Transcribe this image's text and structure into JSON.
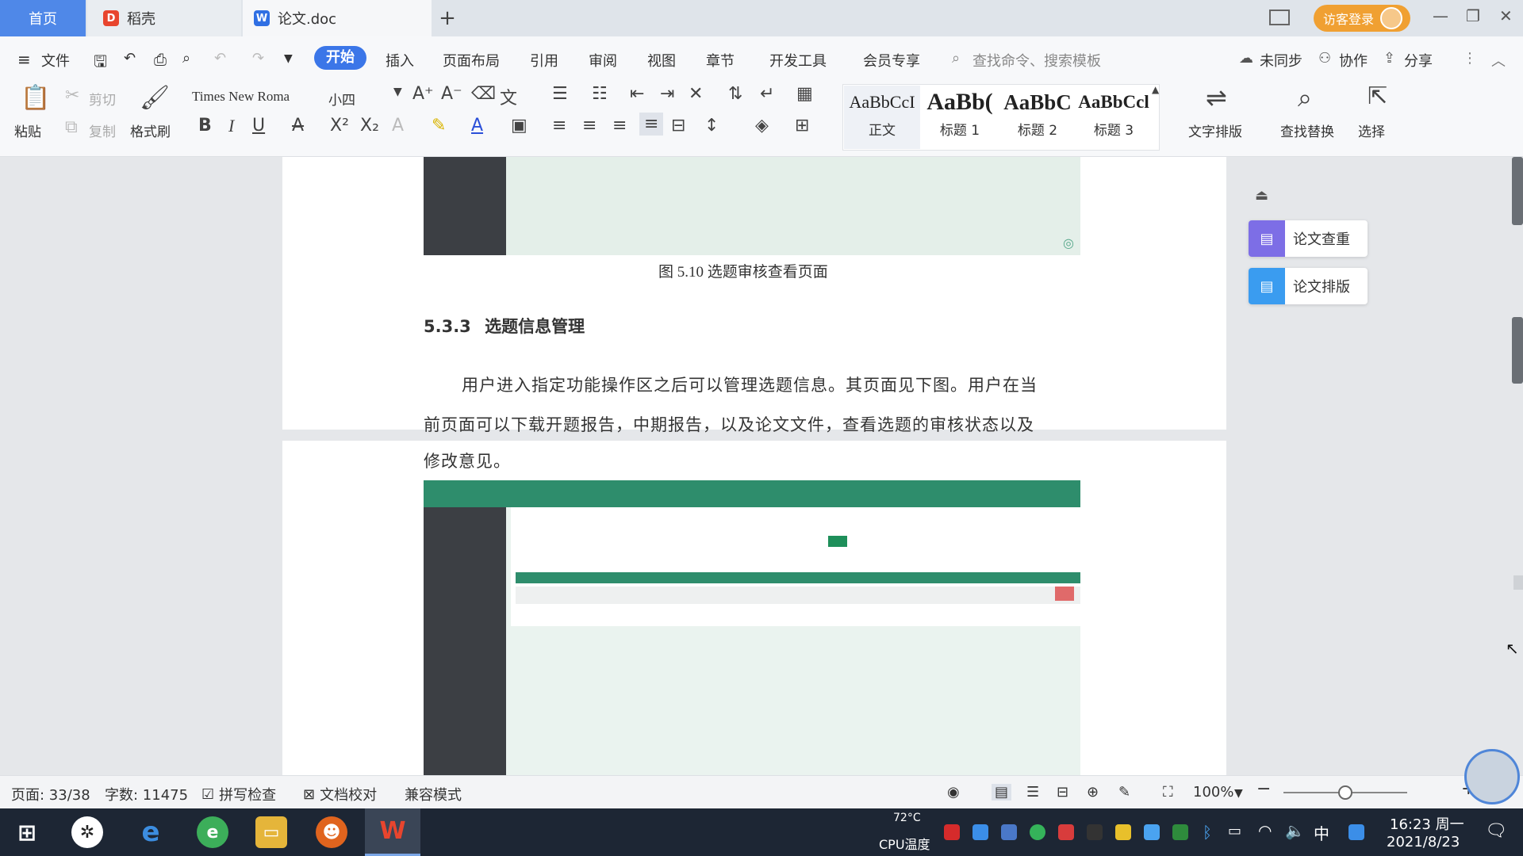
{
  "tabs": {
    "home": "首页",
    "daoke": "稻壳",
    "doc": "论文.doc",
    "add": "+"
  },
  "titlebar": {
    "login": "访客登录"
  },
  "menu": {
    "file": "文件",
    "items": [
      "开始",
      "插入",
      "页面布局",
      "引用",
      "审阅",
      "视图",
      "章节",
      "开发工具",
      "会员专享"
    ],
    "search_placeholder": "查找命令、搜索模板",
    "sync": "未同步",
    "collab": "协作",
    "share": "分享"
  },
  "ribbon": {
    "paste": "粘贴",
    "cut": "剪切",
    "copy": "复制",
    "format_painter": "格式刷",
    "font_name": "Times New Roma",
    "font_size": "小四",
    "styles": [
      {
        "preview": "AaBbCcI",
        "name": "正文"
      },
      {
        "preview": "AaBb(",
        "name": "标题 1"
      },
      {
        "preview": "AaBbC",
        "name": "标题 2"
      },
      {
        "preview": "AaBbCcl",
        "name": "标题 3"
      }
    ],
    "text_layout": "文字排版",
    "find_replace": "查找替换",
    "select": "选择"
  },
  "document": {
    "figure_caption": "图 5.10  选题审核查看页面",
    "section_number": "5.3.3",
    "section_title": "选题信息管理",
    "para_line1": "用户进入指定功能操作区之后可以管理选题信息。其页面见下图。用户在当",
    "para_line2": "前页面可以下载开题报告，中期报告，以及论文文件，查看选题的审核状态以及",
    "para_line3": "修改意见。"
  },
  "side_panel": {
    "check": "论文查重",
    "layout": "论文排版"
  },
  "status": {
    "page": "页面: 33/38",
    "words": "字数: 11475",
    "spell": "拼写检查",
    "proof": "文档校对",
    "compat": "兼容模式",
    "zoom": "100%",
    "zoom_level": 0.5
  },
  "taskbar": {
    "cpu_temp": "72°C",
    "cpu_label": "CPU温度",
    "time": "16:23 周一",
    "date": "2021/8/23",
    "ime": "中"
  }
}
